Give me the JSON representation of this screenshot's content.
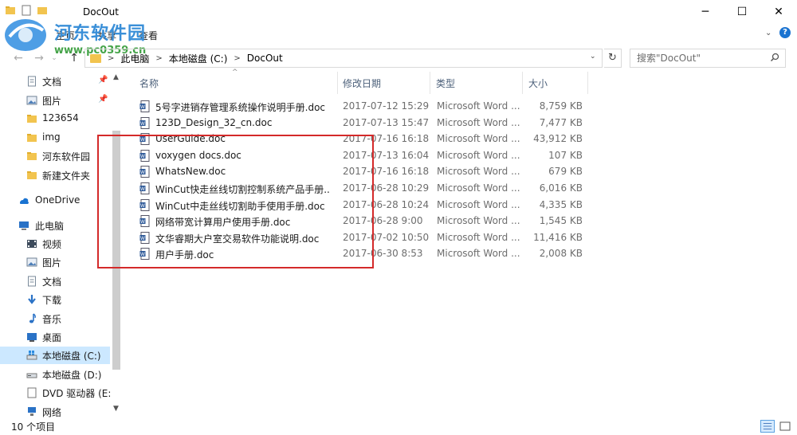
{
  "window": {
    "title": "DocOut",
    "minimize_glyph": "─",
    "maximize_glyph": "☐",
    "close_glyph": "✕"
  },
  "watermark": {
    "title": "河东软件园",
    "url": "www.pc0359.cn"
  },
  "ribbon": {
    "tabs": [
      "文件",
      "主页",
      "共享",
      "查看"
    ],
    "expand_glyph": "⌄",
    "help_glyph": "?"
  },
  "address": {
    "back_glyph": "←",
    "forward_glyph": "→",
    "recent_glyph": "⌄",
    "up_glyph": "↑",
    "crumbs": [
      "此电脑",
      "本地磁盘 (C:)",
      "DocOut"
    ],
    "separator": ">",
    "dropdown_glyph": "⌄",
    "refresh_glyph": "↻"
  },
  "search": {
    "placeholder": "搜索\"DocOut\""
  },
  "sidebar": {
    "quick_access": [
      {
        "label": "文档",
        "icon": "document-icon",
        "pinned": true
      },
      {
        "label": "图片",
        "icon": "pictures-icon",
        "pinned": true
      },
      {
        "label": "123654",
        "icon": "folder-icon",
        "pinned": false
      },
      {
        "label": "img",
        "icon": "folder-icon",
        "pinned": false
      },
      {
        "label": "河东软件园",
        "icon": "folder-icon",
        "pinned": false
      },
      {
        "label": "新建文件夹",
        "icon": "folder-icon",
        "pinned": false
      }
    ],
    "onedrive": "OneDrive",
    "this_pc": "此电脑",
    "pc_items": [
      {
        "label": "视频",
        "icon": "video-icon"
      },
      {
        "label": "图片",
        "icon": "pictures-icon"
      },
      {
        "label": "文档",
        "icon": "document-icon"
      },
      {
        "label": "下载",
        "icon": "download-icon"
      },
      {
        "label": "音乐",
        "icon": "music-icon"
      },
      {
        "label": "桌面",
        "icon": "desktop-icon"
      },
      {
        "label": "本地磁盘 (C:)",
        "icon": "windows-drive-icon",
        "selected": true
      },
      {
        "label": "本地磁盘 (D:)",
        "icon": "drive-icon"
      },
      {
        "label": "DVD 驱动器 (E:)",
        "icon": "dvd-icon"
      },
      {
        "label": "网络",
        "icon": "network-icon"
      }
    ],
    "pin_glyph": "📌",
    "scroll_up_glyph": "▲",
    "scroll_down_glyph": "▼"
  },
  "columns": {
    "name": "名称",
    "date": "修改日期",
    "type": "类型",
    "size": "大小",
    "sort_glyph": "^"
  },
  "files": [
    {
      "name": "5号字进销存管理系统操作说明手册.doc",
      "date": "2017-07-12 15:29",
      "type": "Microsoft Word ...",
      "size": "8,759 KB"
    },
    {
      "name": "123D_Design_32_cn.doc",
      "date": "2017-07-13 15:47",
      "type": "Microsoft Word ...",
      "size": "7,477 KB"
    },
    {
      "name": "UserGuide.doc",
      "date": "2017-07-16 16:18",
      "type": "Microsoft Word ...",
      "size": "43,912 KB"
    },
    {
      "name": "voxygen docs.doc",
      "date": "2017-07-13 16:04",
      "type": "Microsoft Word ...",
      "size": "107 KB"
    },
    {
      "name": "WhatsNew.doc",
      "date": "2017-07-16 16:18",
      "type": "Microsoft Word ...",
      "size": "679 KB"
    },
    {
      "name": "WinCut快走丝线切割控制系统产品手册....",
      "date": "2017-06-28 10:29",
      "type": "Microsoft Word ...",
      "size": "6,016 KB"
    },
    {
      "name": "WinCut中走丝线切割助手使用手册.doc",
      "date": "2017-06-28 10:24",
      "type": "Microsoft Word ...",
      "size": "4,335 KB"
    },
    {
      "name": "网络带宽计算用户使用手册.doc",
      "date": "2017-06-28 9:00",
      "type": "Microsoft Word ...",
      "size": "1,545 KB"
    },
    {
      "name": "文华睿期大户室交易软件功能说明.doc",
      "date": "2017-07-02 10:50",
      "type": "Microsoft Word ...",
      "size": "11,416 KB"
    },
    {
      "name": "用户手册.doc",
      "date": "2017-06-30 8:53",
      "type": "Microsoft Word ...",
      "size": "2,008 KB"
    }
  ],
  "status": {
    "count_text": "10 个项目"
  },
  "colors": {
    "highlight_box": "#d42a2a",
    "selection": "#cce8ff",
    "folder": "#f2c44f",
    "accent": "#1a73d1"
  }
}
